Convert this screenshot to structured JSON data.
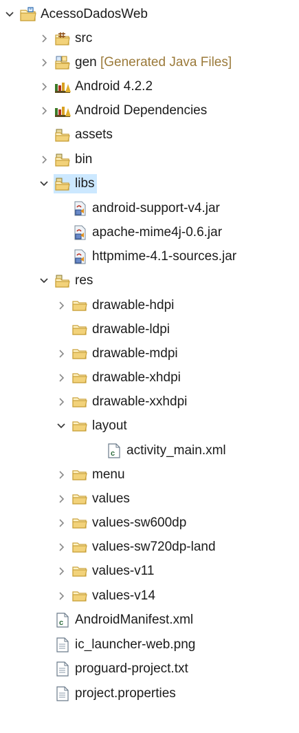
{
  "panel": "Project Explorer",
  "selected_item": "libs",
  "colors": {
    "selection": "#cce8ff",
    "text": "#1b1b1b",
    "decoration": "#9b7a3a",
    "chevron": "#8a8a8a",
    "folder": "#f2d27a"
  },
  "items": [
    {
      "label": "AcessoDadosWeb",
      "level": 0,
      "state": "expanded",
      "icon": "project-icon"
    },
    {
      "label": "src",
      "level": 1,
      "state": "collapsed",
      "icon": "source-folder-icon"
    },
    {
      "label": "gen",
      "decoration": "[Generated Java Files]",
      "level": 1,
      "state": "collapsed",
      "icon": "gen-folder-icon"
    },
    {
      "label": "Android 4.2.2",
      "level": 1,
      "state": "collapsed",
      "icon": "library-icon"
    },
    {
      "label": "Android Dependencies",
      "level": 1,
      "state": "collapsed",
      "icon": "library-icon"
    },
    {
      "label": "assets",
      "level": 1,
      "state": "leaf",
      "icon": "package-folder-icon"
    },
    {
      "label": "bin",
      "level": 1,
      "state": "collapsed",
      "icon": "package-folder-icon"
    },
    {
      "label": "libs",
      "level": 1,
      "state": "expanded",
      "icon": "package-folder-icon"
    },
    {
      "label": "android-support-v4.jar",
      "level": 2,
      "state": "leaf",
      "icon": "jar-icon"
    },
    {
      "label": "apache-mime4j-0.6.jar",
      "level": 2,
      "state": "leaf",
      "icon": "jar-icon"
    },
    {
      "label": "httpmime-4.1-sources.jar",
      "level": 2,
      "state": "leaf",
      "icon": "jar-icon"
    },
    {
      "label": "res",
      "level": 1,
      "state": "expanded",
      "icon": "package-folder-icon"
    },
    {
      "label": "drawable-hdpi",
      "level": 2,
      "state": "collapsed",
      "icon": "folder-icon"
    },
    {
      "label": "drawable-ldpi",
      "level": 2,
      "state": "leaf",
      "icon": "folder-icon"
    },
    {
      "label": "drawable-mdpi",
      "level": 2,
      "state": "collapsed",
      "icon": "folder-icon"
    },
    {
      "label": "drawable-xhdpi",
      "level": 2,
      "state": "collapsed",
      "icon": "folder-icon"
    },
    {
      "label": "drawable-xxhdpi",
      "level": 2,
      "state": "collapsed",
      "icon": "folder-icon"
    },
    {
      "label": "layout",
      "level": 2,
      "state": "expanded",
      "icon": "folder-icon"
    },
    {
      "label": "activity_main.xml",
      "level": 3,
      "state": "leaf",
      "icon": "xml-file-icon"
    },
    {
      "label": "menu",
      "level": 2,
      "state": "collapsed",
      "icon": "folder-icon"
    },
    {
      "label": "values",
      "level": 2,
      "state": "collapsed",
      "icon": "folder-icon"
    },
    {
      "label": "values-sw600dp",
      "level": 2,
      "state": "collapsed",
      "icon": "folder-icon"
    },
    {
      "label": "values-sw720dp-land",
      "level": 2,
      "state": "collapsed",
      "icon": "folder-icon"
    },
    {
      "label": "values-v11",
      "level": 2,
      "state": "collapsed",
      "icon": "folder-icon"
    },
    {
      "label": "values-v14",
      "level": 2,
      "state": "collapsed",
      "icon": "folder-icon"
    },
    {
      "label": "AndroidManifest.xml",
      "level": 1,
      "state": "leaf",
      "icon": "xml-file-icon"
    },
    {
      "label": "ic_launcher-web.png",
      "level": 1,
      "state": "leaf",
      "icon": "file-icon"
    },
    {
      "label": "proguard-project.txt",
      "level": 1,
      "state": "leaf",
      "icon": "file-icon"
    },
    {
      "label": "project.properties",
      "level": 1,
      "state": "leaf",
      "icon": "file-icon"
    }
  ]
}
